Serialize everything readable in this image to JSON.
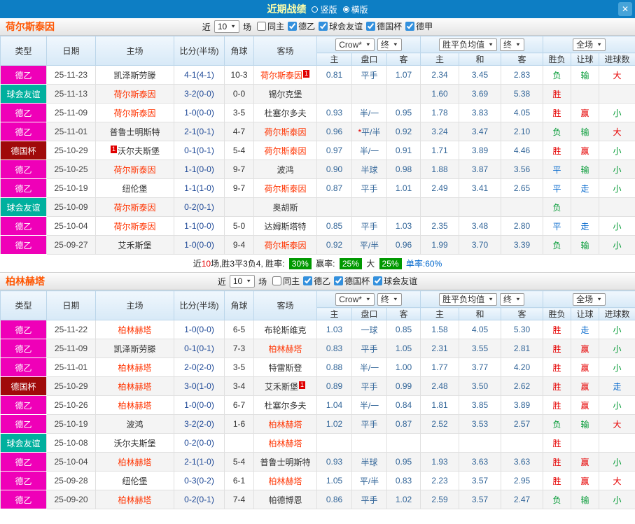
{
  "topbar": {
    "title": "近期战绩",
    "vertical_label": "竖版",
    "horizontal_label": "横版",
    "selected_layout": "横版",
    "close": "✕"
  },
  "icons": {
    "dropdown_arrow": "▼"
  },
  "colors": {
    "topbar": "#0d7ec4",
    "title": "#ffffaa",
    "de2": "#ef00b8",
    "friendly": "#00b09e",
    "cup": "#a00a0a",
    "red": "#e60000",
    "green": "#009933",
    "blue": "#0066cc",
    "team-hl": "#ff3300",
    "team-title": "#ff5500",
    "odds": "#336699",
    "score": "#1c4796",
    "badge": "#009900"
  },
  "sections": [
    {
      "team": "荷尔斯泰因",
      "filter": {
        "prefix": "近",
        "count": "10",
        "suffix": "场",
        "checkboxes": [
          {
            "label": "同主",
            "checked": false
          },
          {
            "label": "德乙",
            "checked": true
          },
          {
            "label": "球会友谊",
            "checked": true
          },
          {
            "label": "德国杯",
            "checked": true
          },
          {
            "label": "德甲",
            "checked": true
          }
        ]
      },
      "header": {
        "type": "类型",
        "date": "日期",
        "home": "主场",
        "score": "比分(半场)",
        "corner": "角球",
        "away": "客场",
        "company": "Crow*",
        "final1": "终",
        "avg": "胜平负均值",
        "final2": "终",
        "scope": "全场",
        "sub": [
          "主",
          "盘口",
          "客",
          "主",
          "和",
          "客",
          "胜负",
          "让球",
          "进球数"
        ]
      },
      "rows": [
        {
          "lg": "德乙",
          "lgc": "de2",
          "date": "25-11-23",
          "home": {
            "n": "凯泽斯劳滕",
            "hl": 0
          },
          "score": "4-1(4-1)",
          "corner": "10-3",
          "away": {
            "n": "荷尔斯泰因",
            "hl": 1,
            "b": "1",
            "bp": "after"
          },
          "ah": [
            "0.81",
            "平手",
            "1.07"
          ],
          "eu": [
            "2.34",
            "3.45",
            "2.83"
          ],
          "res": [
            "负",
            "g"
          ],
          "hcp": [
            "输",
            "g"
          ],
          "goal": [
            "大",
            "r"
          ]
        },
        {
          "lg": "球会友谊",
          "lgc": "friendly",
          "date": "25-11-13",
          "home": {
            "n": "荷尔斯泰因",
            "hl": 1
          },
          "score": "3-2(0-0)",
          "corner": "0-0",
          "away": {
            "n": "锡尔克堡",
            "hl": 0
          },
          "ah": [
            "",
            "",
            ""
          ],
          "eu": [
            "1.60",
            "3.69",
            "5.38"
          ],
          "res": [
            "胜",
            "r"
          ],
          "hcp": [
            "",
            ""
          ],
          "goal": [
            "",
            ""
          ]
        },
        {
          "lg": "德乙",
          "lgc": "de2",
          "date": "25-11-09",
          "home": {
            "n": "荷尔斯泰因",
            "hl": 1
          },
          "score": "1-0(0-0)",
          "corner": "3-5",
          "away": {
            "n": "杜塞尔多夫",
            "hl": 0
          },
          "ah": [
            "0.93",
            "半/一",
            "0.95"
          ],
          "eu": [
            "1.78",
            "3.83",
            "4.05"
          ],
          "res": [
            "胜",
            "r"
          ],
          "hcp": [
            "赢",
            "r"
          ],
          "goal": [
            "小",
            "g"
          ]
        },
        {
          "lg": "德乙",
          "lgc": "de2",
          "date": "25-11-01",
          "home": {
            "n": "普鲁士明斯特",
            "hl": 0
          },
          "score": "2-1(0-1)",
          "corner": "4-7",
          "away": {
            "n": "荷尔斯泰因",
            "hl": 1
          },
          "ah": [
            "0.96",
            "*平/半",
            "0.92"
          ],
          "eu": [
            "3.24",
            "3.47",
            "2.10"
          ],
          "res": [
            "负",
            "g"
          ],
          "hcp": [
            "输",
            "g"
          ],
          "goal": [
            "大",
            "r"
          ]
        },
        {
          "lg": "德国杯",
          "lgc": "cup",
          "date": "25-10-29",
          "home": {
            "n": "沃尔夫斯堡",
            "hl": 0,
            "b": "1",
            "bp": "before"
          },
          "score": "0-1(0-1)",
          "corner": "5-4",
          "away": {
            "n": "荷尔斯泰因",
            "hl": 1
          },
          "ah": [
            "0.97",
            "半/一",
            "0.91"
          ],
          "eu": [
            "1.71",
            "3.89",
            "4.46"
          ],
          "res": [
            "胜",
            "r"
          ],
          "hcp": [
            "赢",
            "r"
          ],
          "goal": [
            "小",
            "g"
          ]
        },
        {
          "lg": "德乙",
          "lgc": "de2",
          "date": "25-10-25",
          "home": {
            "n": "荷尔斯泰因",
            "hl": 1
          },
          "score": "1-1(0-0)",
          "corner": "9-7",
          "away": {
            "n": "波鸿",
            "hl": 0
          },
          "ah": [
            "0.90",
            "半球",
            "0.98"
          ],
          "eu": [
            "1.88",
            "3.87",
            "3.56"
          ],
          "res": [
            "平",
            "b"
          ],
          "hcp": [
            "输",
            "g"
          ],
          "goal": [
            "小",
            "g"
          ]
        },
        {
          "lg": "德乙",
          "lgc": "de2",
          "date": "25-10-19",
          "home": {
            "n": "纽伦堡",
            "hl": 0
          },
          "score": "1-1(1-0)",
          "corner": "9-7",
          "away": {
            "n": "荷尔斯泰因",
            "hl": 1
          },
          "ah": [
            "0.87",
            "平手",
            "1.01"
          ],
          "eu": [
            "2.49",
            "3.41",
            "2.65"
          ],
          "res": [
            "平",
            "b"
          ],
          "hcp": [
            "走",
            "b"
          ],
          "goal": [
            "小",
            "g"
          ]
        },
        {
          "lg": "球会友谊",
          "lgc": "friendly",
          "date": "25-10-09",
          "home": {
            "n": "荷尔斯泰因",
            "hl": 1
          },
          "score": "0-2(0-1)",
          "corner": "",
          "away": {
            "n": "奥胡斯",
            "hl": 0
          },
          "ah": [
            "",
            "",
            ""
          ],
          "eu": [
            "",
            "",
            ""
          ],
          "res": [
            "负",
            "g"
          ],
          "hcp": [
            "",
            ""
          ],
          "goal": [
            "",
            ""
          ]
        },
        {
          "lg": "德乙",
          "lgc": "de2",
          "date": "25-10-04",
          "home": {
            "n": "荷尔斯泰因",
            "hl": 1
          },
          "score": "1-1(0-0)",
          "corner": "5-0",
          "away": {
            "n": "达姆斯塔特",
            "hl": 0
          },
          "ah": [
            "0.85",
            "平手",
            "1.03"
          ],
          "eu": [
            "2.35",
            "3.48",
            "2.80"
          ],
          "res": [
            "平",
            "b"
          ],
          "hcp": [
            "走",
            "b"
          ],
          "goal": [
            "小",
            "g"
          ]
        },
        {
          "lg": "德乙",
          "lgc": "de2",
          "date": "25-09-27",
          "home": {
            "n": "艾禾斯堡",
            "hl": 0
          },
          "score": "1-0(0-0)",
          "corner": "9-4",
          "away": {
            "n": "荷尔斯泰因",
            "hl": 1
          },
          "ah": [
            "0.92",
            "平/半",
            "0.96"
          ],
          "eu": [
            "1.99",
            "3.70",
            "3.39"
          ],
          "res": [
            "负",
            "g"
          ],
          "hcp": [
            "输",
            "g"
          ],
          "goal": [
            "小",
            "g"
          ]
        }
      ],
      "summary": [
        {
          "t": "近"
        },
        {
          "t": "10",
          "c": "red"
        },
        {
          "t": "场,胜3平3负4, 胜率: "
        },
        {
          "t": "30%",
          "c": "pct"
        },
        {
          "t": " 赢率: "
        },
        {
          "t": "25%",
          "c": "pct"
        },
        {
          "t": " 大 "
        },
        {
          "t": "25%",
          "c": "pct"
        },
        {
          "t": " 单率:60%",
          "c": "blue"
        }
      ]
    },
    {
      "team": "柏林赫塔",
      "filter": {
        "prefix": "近",
        "count": "10",
        "suffix": "场",
        "checkboxes": [
          {
            "label": "同主",
            "checked": false
          },
          {
            "label": "德乙",
            "checked": true
          },
          {
            "label": "德国杯",
            "checked": true
          },
          {
            "label": "球会友谊",
            "checked": true
          }
        ]
      },
      "header": {
        "type": "类型",
        "date": "日期",
        "home": "主场",
        "score": "比分(半场)",
        "corner": "角球",
        "away": "客场",
        "company": "Crow*",
        "final1": "终",
        "avg": "胜平负均值",
        "final2": "终",
        "scope": "全场",
        "sub": [
          "主",
          "盘口",
          "客",
          "主",
          "和",
          "客",
          "胜负",
          "让球",
          "进球数"
        ]
      },
      "rows": [
        {
          "lg": "德乙",
          "lgc": "de2",
          "date": "25-11-22",
          "home": {
            "n": "柏林赫塔",
            "hl": 1
          },
          "score": "1-0(0-0)",
          "corner": "6-5",
          "away": {
            "n": "布轮斯维克",
            "hl": 0
          },
          "ah": [
            "1.03",
            "一球",
            "0.85"
          ],
          "eu": [
            "1.58",
            "4.05",
            "5.30"
          ],
          "res": [
            "胜",
            "r"
          ],
          "hcp": [
            "走",
            "b"
          ],
          "goal": [
            "小",
            "g"
          ]
        },
        {
          "lg": "德乙",
          "lgc": "de2",
          "date": "25-11-09",
          "home": {
            "n": "凯泽斯劳滕",
            "hl": 0
          },
          "score": "0-1(0-1)",
          "corner": "7-3",
          "away": {
            "n": "柏林赫塔",
            "hl": 1
          },
          "ah": [
            "0.83",
            "平手",
            "1.05"
          ],
          "eu": [
            "2.31",
            "3.55",
            "2.81"
          ],
          "res": [
            "胜",
            "r"
          ],
          "hcp": [
            "赢",
            "r"
          ],
          "goal": [
            "小",
            "g"
          ]
        },
        {
          "lg": "德乙",
          "lgc": "de2",
          "date": "25-11-01",
          "home": {
            "n": "柏林赫塔",
            "hl": 1
          },
          "score": "2-0(2-0)",
          "corner": "3-5",
          "away": {
            "n": "特雷斯登",
            "hl": 0
          },
          "ah": [
            "0.88",
            "半/一",
            "1.00"
          ],
          "eu": [
            "1.77",
            "3.77",
            "4.20"
          ],
          "res": [
            "胜",
            "r"
          ],
          "hcp": [
            "赢",
            "r"
          ],
          "goal": [
            "小",
            "g"
          ]
        },
        {
          "lg": "德国杯",
          "lgc": "cup",
          "date": "25-10-29",
          "home": {
            "n": "柏林赫塔",
            "hl": 1
          },
          "score": "3-0(1-0)",
          "corner": "3-4",
          "away": {
            "n": "艾禾斯堡",
            "hl": 0,
            "b": "1",
            "bp": "after"
          },
          "ah": [
            "0.89",
            "平手",
            "0.99"
          ],
          "eu": [
            "2.48",
            "3.50",
            "2.62"
          ],
          "res": [
            "胜",
            "r"
          ],
          "hcp": [
            "赢",
            "r"
          ],
          "goal": [
            "走",
            "b"
          ]
        },
        {
          "lg": "德乙",
          "lgc": "de2",
          "date": "25-10-26",
          "home": {
            "n": "柏林赫塔",
            "hl": 1
          },
          "score": "1-0(0-0)",
          "corner": "6-7",
          "away": {
            "n": "杜塞尔多夫",
            "hl": 0
          },
          "ah": [
            "1.04",
            "半/一",
            "0.84"
          ],
          "eu": [
            "1.81",
            "3.85",
            "3.89"
          ],
          "res": [
            "胜",
            "r"
          ],
          "hcp": [
            "赢",
            "r"
          ],
          "goal": [
            "小",
            "g"
          ]
        },
        {
          "lg": "德乙",
          "lgc": "de2",
          "date": "25-10-19",
          "home": {
            "n": "波鸿",
            "hl": 0
          },
          "score": "3-2(2-0)",
          "corner": "1-6",
          "away": {
            "n": "柏林赫塔",
            "hl": 1
          },
          "ah": [
            "1.02",
            "平手",
            "0.87"
          ],
          "eu": [
            "2.52",
            "3.53",
            "2.57"
          ],
          "res": [
            "负",
            "g"
          ],
          "hcp": [
            "输",
            "g"
          ],
          "goal": [
            "大",
            "r"
          ]
        },
        {
          "lg": "球会友谊",
          "lgc": "friendly",
          "date": "25-10-08",
          "home": {
            "n": "沃尔夫斯堡",
            "hl": 0
          },
          "score": "0-2(0-0)",
          "corner": "",
          "away": {
            "n": "柏林赫塔",
            "hl": 1
          },
          "ah": [
            "",
            "",
            ""
          ],
          "eu": [
            "",
            "",
            ""
          ],
          "res": [
            "胜",
            "r"
          ],
          "hcp": [
            "",
            ""
          ],
          "goal": [
            "",
            ""
          ]
        },
        {
          "lg": "德乙",
          "lgc": "de2",
          "date": "25-10-04",
          "home": {
            "n": "柏林赫塔",
            "hl": 1
          },
          "score": "2-1(1-0)",
          "corner": "5-4",
          "away": {
            "n": "普鲁士明斯特",
            "hl": 0
          },
          "ah": [
            "0.93",
            "半球",
            "0.95"
          ],
          "eu": [
            "1.93",
            "3.63",
            "3.63"
          ],
          "res": [
            "胜",
            "r"
          ],
          "hcp": [
            "赢",
            "r"
          ],
          "goal": [
            "小",
            "g"
          ]
        },
        {
          "lg": "德乙",
          "lgc": "de2",
          "date": "25-09-28",
          "home": {
            "n": "纽伦堡",
            "hl": 0
          },
          "score": "0-3(0-2)",
          "corner": "6-1",
          "away": {
            "n": "柏林赫塔",
            "hl": 1
          },
          "ah": [
            "1.05",
            "平/半",
            "0.83"
          ],
          "eu": [
            "2.23",
            "3.57",
            "2.95"
          ],
          "res": [
            "胜",
            "r"
          ],
          "hcp": [
            "赢",
            "r"
          ],
          "goal": [
            "大",
            "r"
          ]
        },
        {
          "lg": "德乙",
          "lgc": "de2",
          "date": "25-09-20",
          "home": {
            "n": "柏林赫塔",
            "hl": 1
          },
          "score": "0-2(0-1)",
          "corner": "7-4",
          "away": {
            "n": "帕德博恩",
            "hl": 0
          },
          "ah": [
            "0.86",
            "平手",
            "1.02"
          ],
          "eu": [
            "2.59",
            "3.57",
            "2.47"
          ],
          "res": [
            "负",
            "g"
          ],
          "hcp": [
            "输",
            "g"
          ],
          "goal": [
            "小",
            "g"
          ]
        }
      ],
      "summary": null
    }
  ]
}
